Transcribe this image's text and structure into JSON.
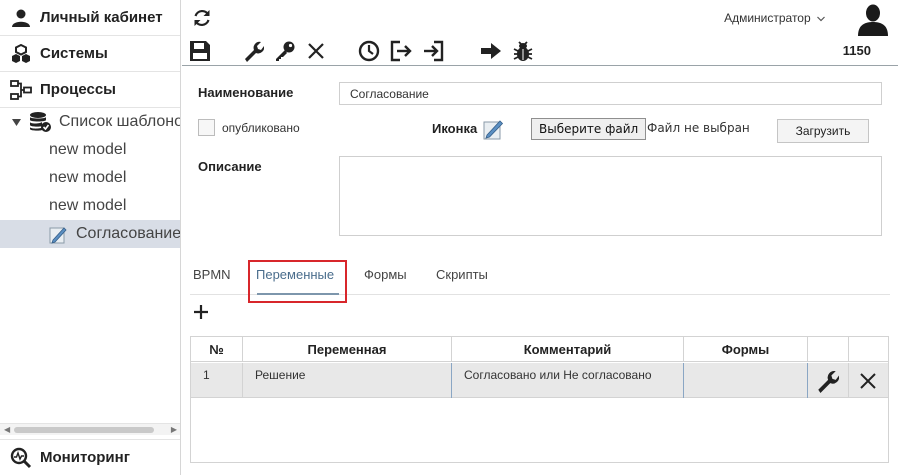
{
  "sidebar": {
    "personal_label": "Личный кабинет",
    "systems_label": "Системы",
    "processes_label": "Процессы",
    "template_list_label": "Список шаблонов",
    "models": [
      "new model",
      "new model",
      "new model"
    ],
    "selected_label": "Согласование",
    "monitoring_label": "Мониторинг"
  },
  "header": {
    "user_label": "Администратор",
    "count": "1150"
  },
  "form": {
    "name_label": "Наименование",
    "name_value": "Согласование",
    "published_label": "опубликовано",
    "published_checked": false,
    "icon_label": "Иконка",
    "file_button_label": "Выберите файл",
    "file_status": "Файл не выбран",
    "upload_label": "Загрузить",
    "description_label": "Описание",
    "description_value": ""
  },
  "tabs": [
    "BPMN",
    "Переменные",
    "Формы",
    "Скрипты"
  ],
  "active_tab": "Переменные",
  "table": {
    "columns": [
      "№",
      "Переменная",
      "Комментарий",
      "Формы"
    ],
    "rows": [
      {
        "num": "1",
        "variable": "Решение",
        "comment": "Согласовано или Не согласовано",
        "forms": ""
      }
    ]
  },
  "colors": {
    "accent": "#4a6d8c",
    "highlight": "#d8262b",
    "selected_row": "#d8dde6"
  }
}
